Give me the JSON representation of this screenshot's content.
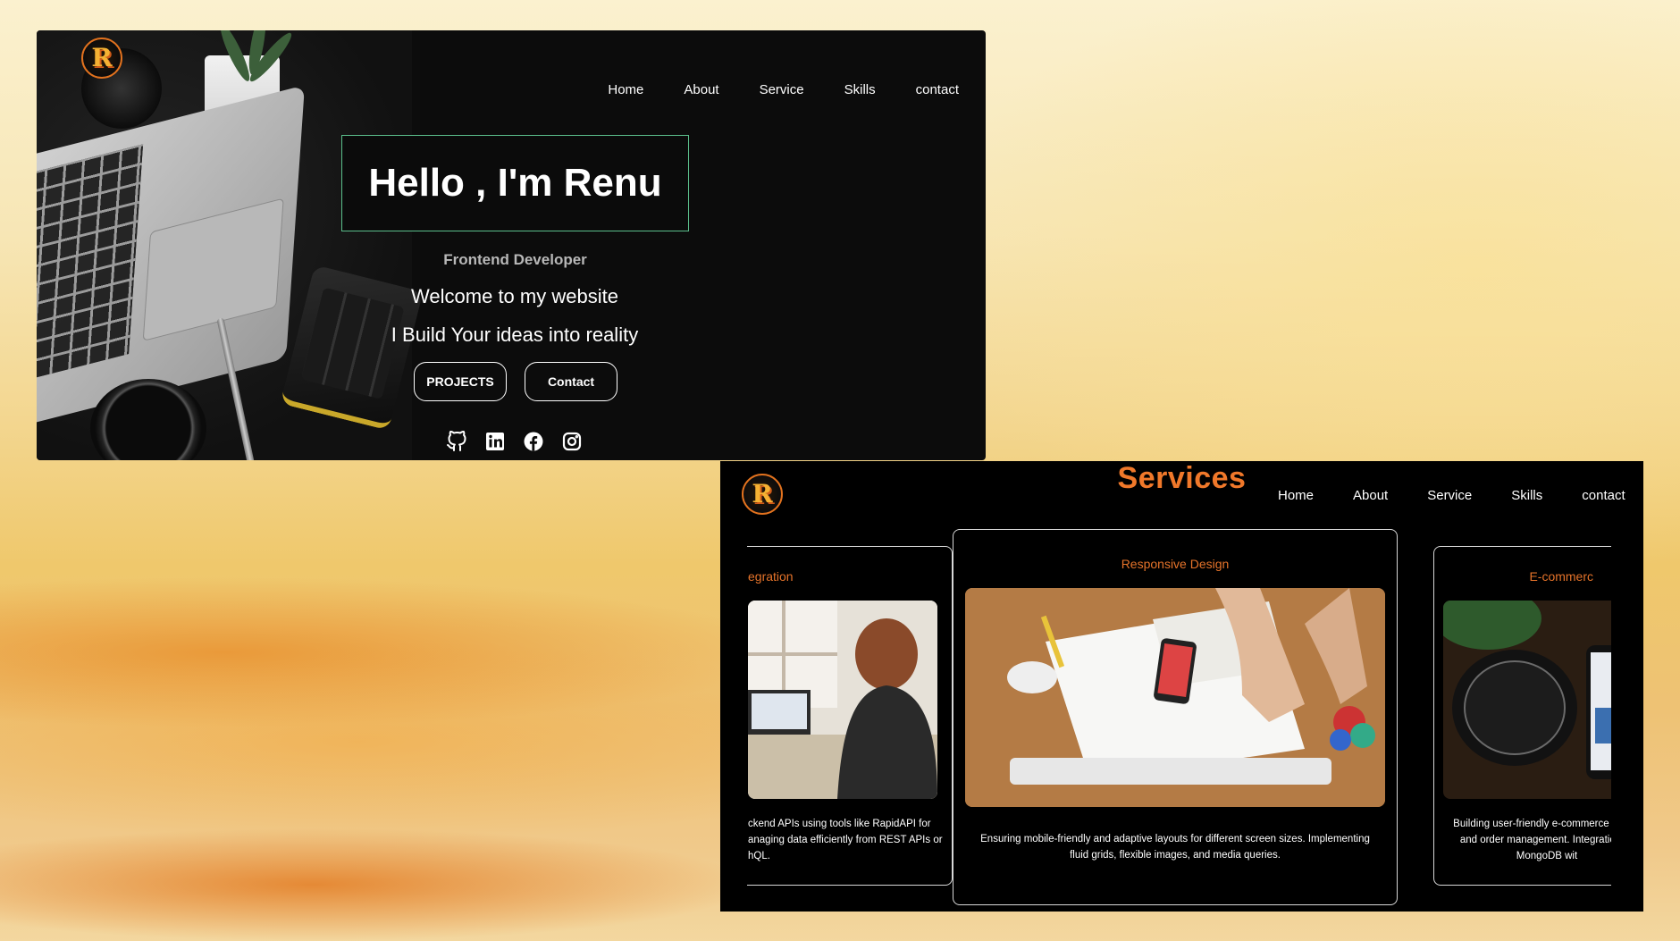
{
  "hero": {
    "logo_letter": "R",
    "nav": [
      "Home",
      "About",
      "Service",
      "Skills",
      "contact"
    ],
    "headline": "Hello , I'm Renu",
    "role": "Frontend Developer",
    "welcome": "Welcome to my website",
    "tagline": "I Build Your ideas into reality",
    "buttons": {
      "projects": "PROJECTS",
      "contact": "Contact"
    },
    "socials": [
      "github-icon",
      "linkedin-icon",
      "facebook-icon",
      "instagram-icon"
    ]
  },
  "services": {
    "logo_letter": "R",
    "title": "Services",
    "nav": [
      "Home",
      "About",
      "Service",
      "Skills",
      "contact"
    ],
    "cards": [
      {
        "title": "egration",
        "desc_lines": [
          "ckend APIs using tools like RapidAPI for",
          "anaging data efficiently from REST APIs or",
          "hQL."
        ]
      },
      {
        "title": "Responsive Design",
        "desc_lines": [
          "Ensuring mobile-friendly and adaptive layouts for different screen sizes. Implementing",
          "fluid grids, flexible images, and media queries."
        ]
      },
      {
        "title": "E-commerc",
        "desc_lines": [
          "Building user-friendly e-commerce interfa",
          "and order management. Integration wi",
          "MongoDB wit"
        ]
      }
    ]
  },
  "colors": {
    "accent_orange": "#f0782a",
    "hello_border": "#5bbf8c",
    "panel_bg": "#000000"
  }
}
